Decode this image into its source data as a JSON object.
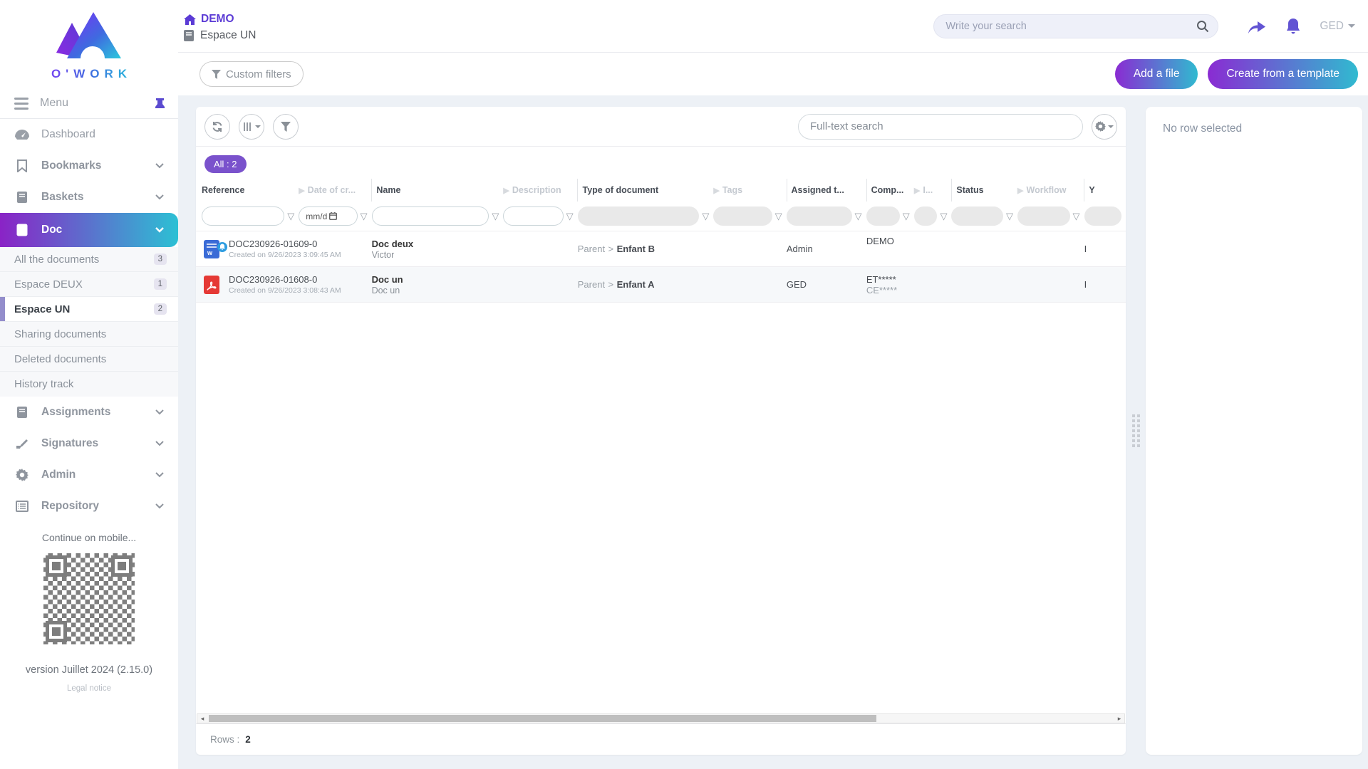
{
  "brand": {
    "name": "O'WORK"
  },
  "colors": {
    "accent_purple": "#6254d3",
    "badge_purple": "#7a52cc",
    "gradient_start": "#8a2bd2",
    "gradient_end": "#30bad0",
    "word_doc_blue": "#3a6bd6",
    "pdf_red": "#e53935"
  },
  "header": {
    "breadcrumb_home": "DEMO",
    "space_title": "Espace UN",
    "search_placeholder": "Write your search",
    "user_menu": "GED"
  },
  "actionbar": {
    "custom_filters": "Custom filters",
    "add_file": "Add a file",
    "create_template": "Create from a template"
  },
  "sidebar": {
    "menu_label": "Menu",
    "nav": {
      "dashboard": "Dashboard",
      "bookmarks": "Bookmarks",
      "baskets": "Baskets",
      "doc": "Doc",
      "assignments": "Assignments",
      "signatures": "Signatures",
      "admin": "Admin",
      "repository": "Repository"
    },
    "doc_children": [
      {
        "label": "All the documents",
        "count": "3"
      },
      {
        "label": "Espace DEUX",
        "count": "1"
      },
      {
        "label": "Espace UN",
        "count": "2"
      },
      {
        "label": "Sharing documents",
        "count": ""
      },
      {
        "label": "Deleted documents",
        "count": ""
      },
      {
        "label": "History track",
        "count": ""
      }
    ],
    "mobile_hint": "Continue on mobile...",
    "version": "version Juillet 2024 (2.15.0)",
    "legal": "Legal notice"
  },
  "table": {
    "fulltext_placeholder": "Full-text search",
    "badge_all": "All : 2",
    "date_filter_placeholder": "mm/d",
    "type_separator": ">",
    "columns": [
      {
        "label": "Reference"
      },
      {
        "label": "Date of cr..."
      },
      {
        "label": "Name"
      },
      {
        "label": "Description"
      },
      {
        "label": "Type of document"
      },
      {
        "label": "Tags"
      },
      {
        "label": "Assigned t..."
      },
      {
        "label": "Comp..."
      },
      {
        "label": "I..."
      },
      {
        "label": "Status"
      },
      {
        "label": "Workflow"
      },
      {
        "label": "Y"
      }
    ],
    "rows": [
      {
        "icon": "word-document-notification",
        "reference": "DOC230926-01609-0",
        "created": "Created on 9/26/2023 3:09:45 AM",
        "name": "Doc deux",
        "name_sub": "Victor",
        "type_parent": "Parent",
        "type_child": "Enfant B",
        "assigned_to": "Admin",
        "company_line1": "DEMO",
        "company_line2": "",
        "cut_text": "I"
      },
      {
        "icon": "pdf-document",
        "reference": "DOC230926-01608-0",
        "created": "Created on 9/26/2023 3:08:43 AM",
        "name": "Doc un",
        "name_sub": "Doc un",
        "type_parent": "Parent",
        "type_child": "Enfant A",
        "assigned_to": "GED",
        "company_line1": "ET*****",
        "company_line2": "CE*****",
        "cut_text": "I"
      }
    ],
    "footer": {
      "rows_label": "Rows :",
      "rows_value": "2"
    }
  },
  "right_panel": {
    "empty_text": "No row selected"
  }
}
